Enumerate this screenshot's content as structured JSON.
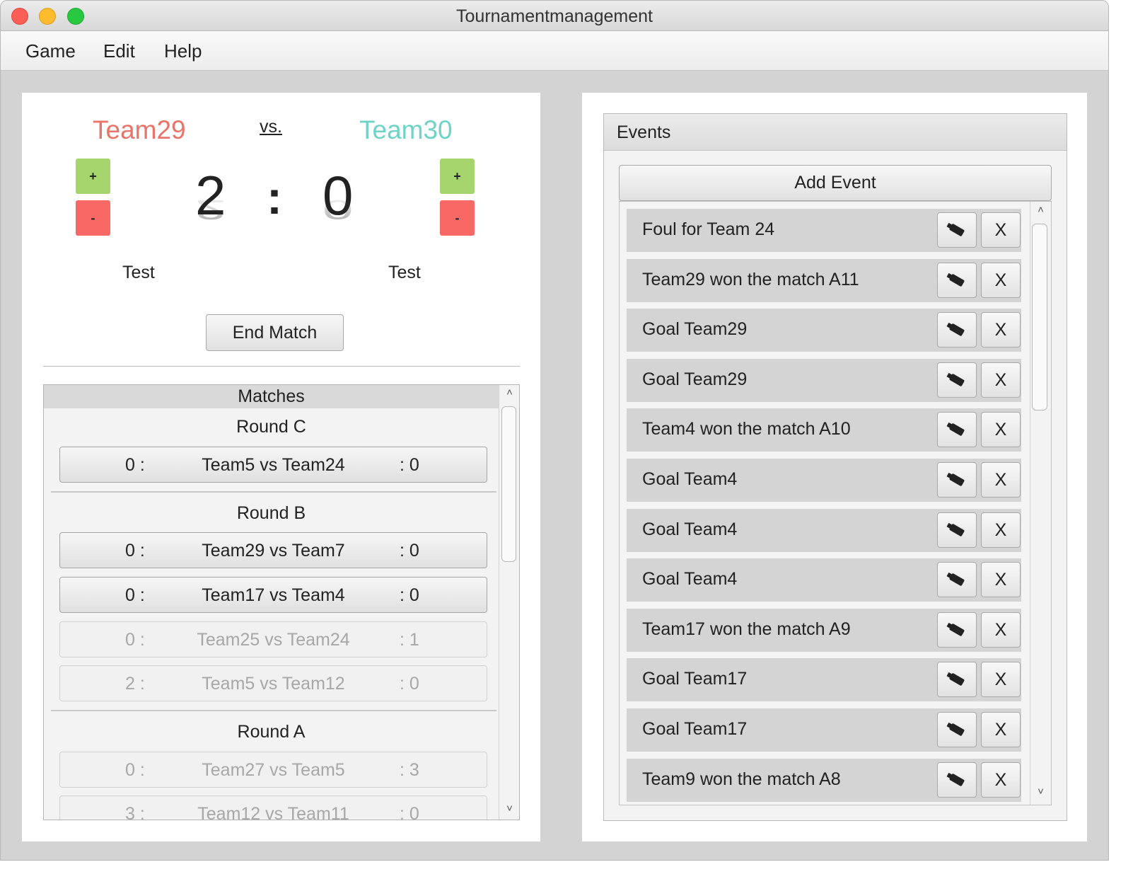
{
  "window": {
    "title": "Tournamentmanagement"
  },
  "menu": [
    "Game",
    "Edit",
    "Help"
  ],
  "match": {
    "team_a": "Team29",
    "team_b": "Team30",
    "vs": "vs.",
    "score_a": "2",
    "score_b": "0",
    "separator": ":",
    "plus_label": "+",
    "minus_label": "-",
    "player_a": "Test",
    "player_b": "Test",
    "end_match_label": "End Match",
    "colors": {
      "team_a": "#e8746a",
      "team_b": "#6fd3c7",
      "plus": "#a6d56e",
      "minus": "#f86966"
    }
  },
  "matches": {
    "header": "Matches",
    "rounds": [
      {
        "title": "Round C",
        "items": [
          {
            "left": "0 :",
            "label": "Team5 vs Team24",
            "right": ": 0",
            "enabled": true
          }
        ]
      },
      {
        "title": "Round B",
        "items": [
          {
            "left": "0 :",
            "label": "Team29 vs Team7",
            "right": ": 0",
            "enabled": true
          },
          {
            "left": "0 :",
            "label": "Team17 vs Team4",
            "right": ": 0",
            "enabled": true
          },
          {
            "left": "0 :",
            "label": "Team25 vs Team24",
            "right": ": 1",
            "enabled": false
          },
          {
            "left": "2 :",
            "label": "Team5 vs Team12",
            "right": ": 0",
            "enabled": false
          }
        ]
      },
      {
        "title": "Round A",
        "items": [
          {
            "left": "0 :",
            "label": "Team27 vs Team5",
            "right": ": 3",
            "enabled": false
          },
          {
            "left": "3 :",
            "label": "Team12 vs Team11",
            "right": ": 0",
            "enabled": false
          }
        ]
      }
    ]
  },
  "events": {
    "header": "Events",
    "add_label": "Add Event",
    "delete_label": "X",
    "edit_icon": "eraser-icon",
    "items": [
      "Foul for Team 24",
      "Team29 won the match A11",
      "Goal Team29",
      "Goal Team29",
      "Team4 won the match A10",
      "Goal Team4",
      "Goal Team4",
      "Goal Team4",
      "Team17 won the match A9",
      "Goal Team17",
      "Goal Team17",
      "Team9 won the match A8"
    ]
  }
}
